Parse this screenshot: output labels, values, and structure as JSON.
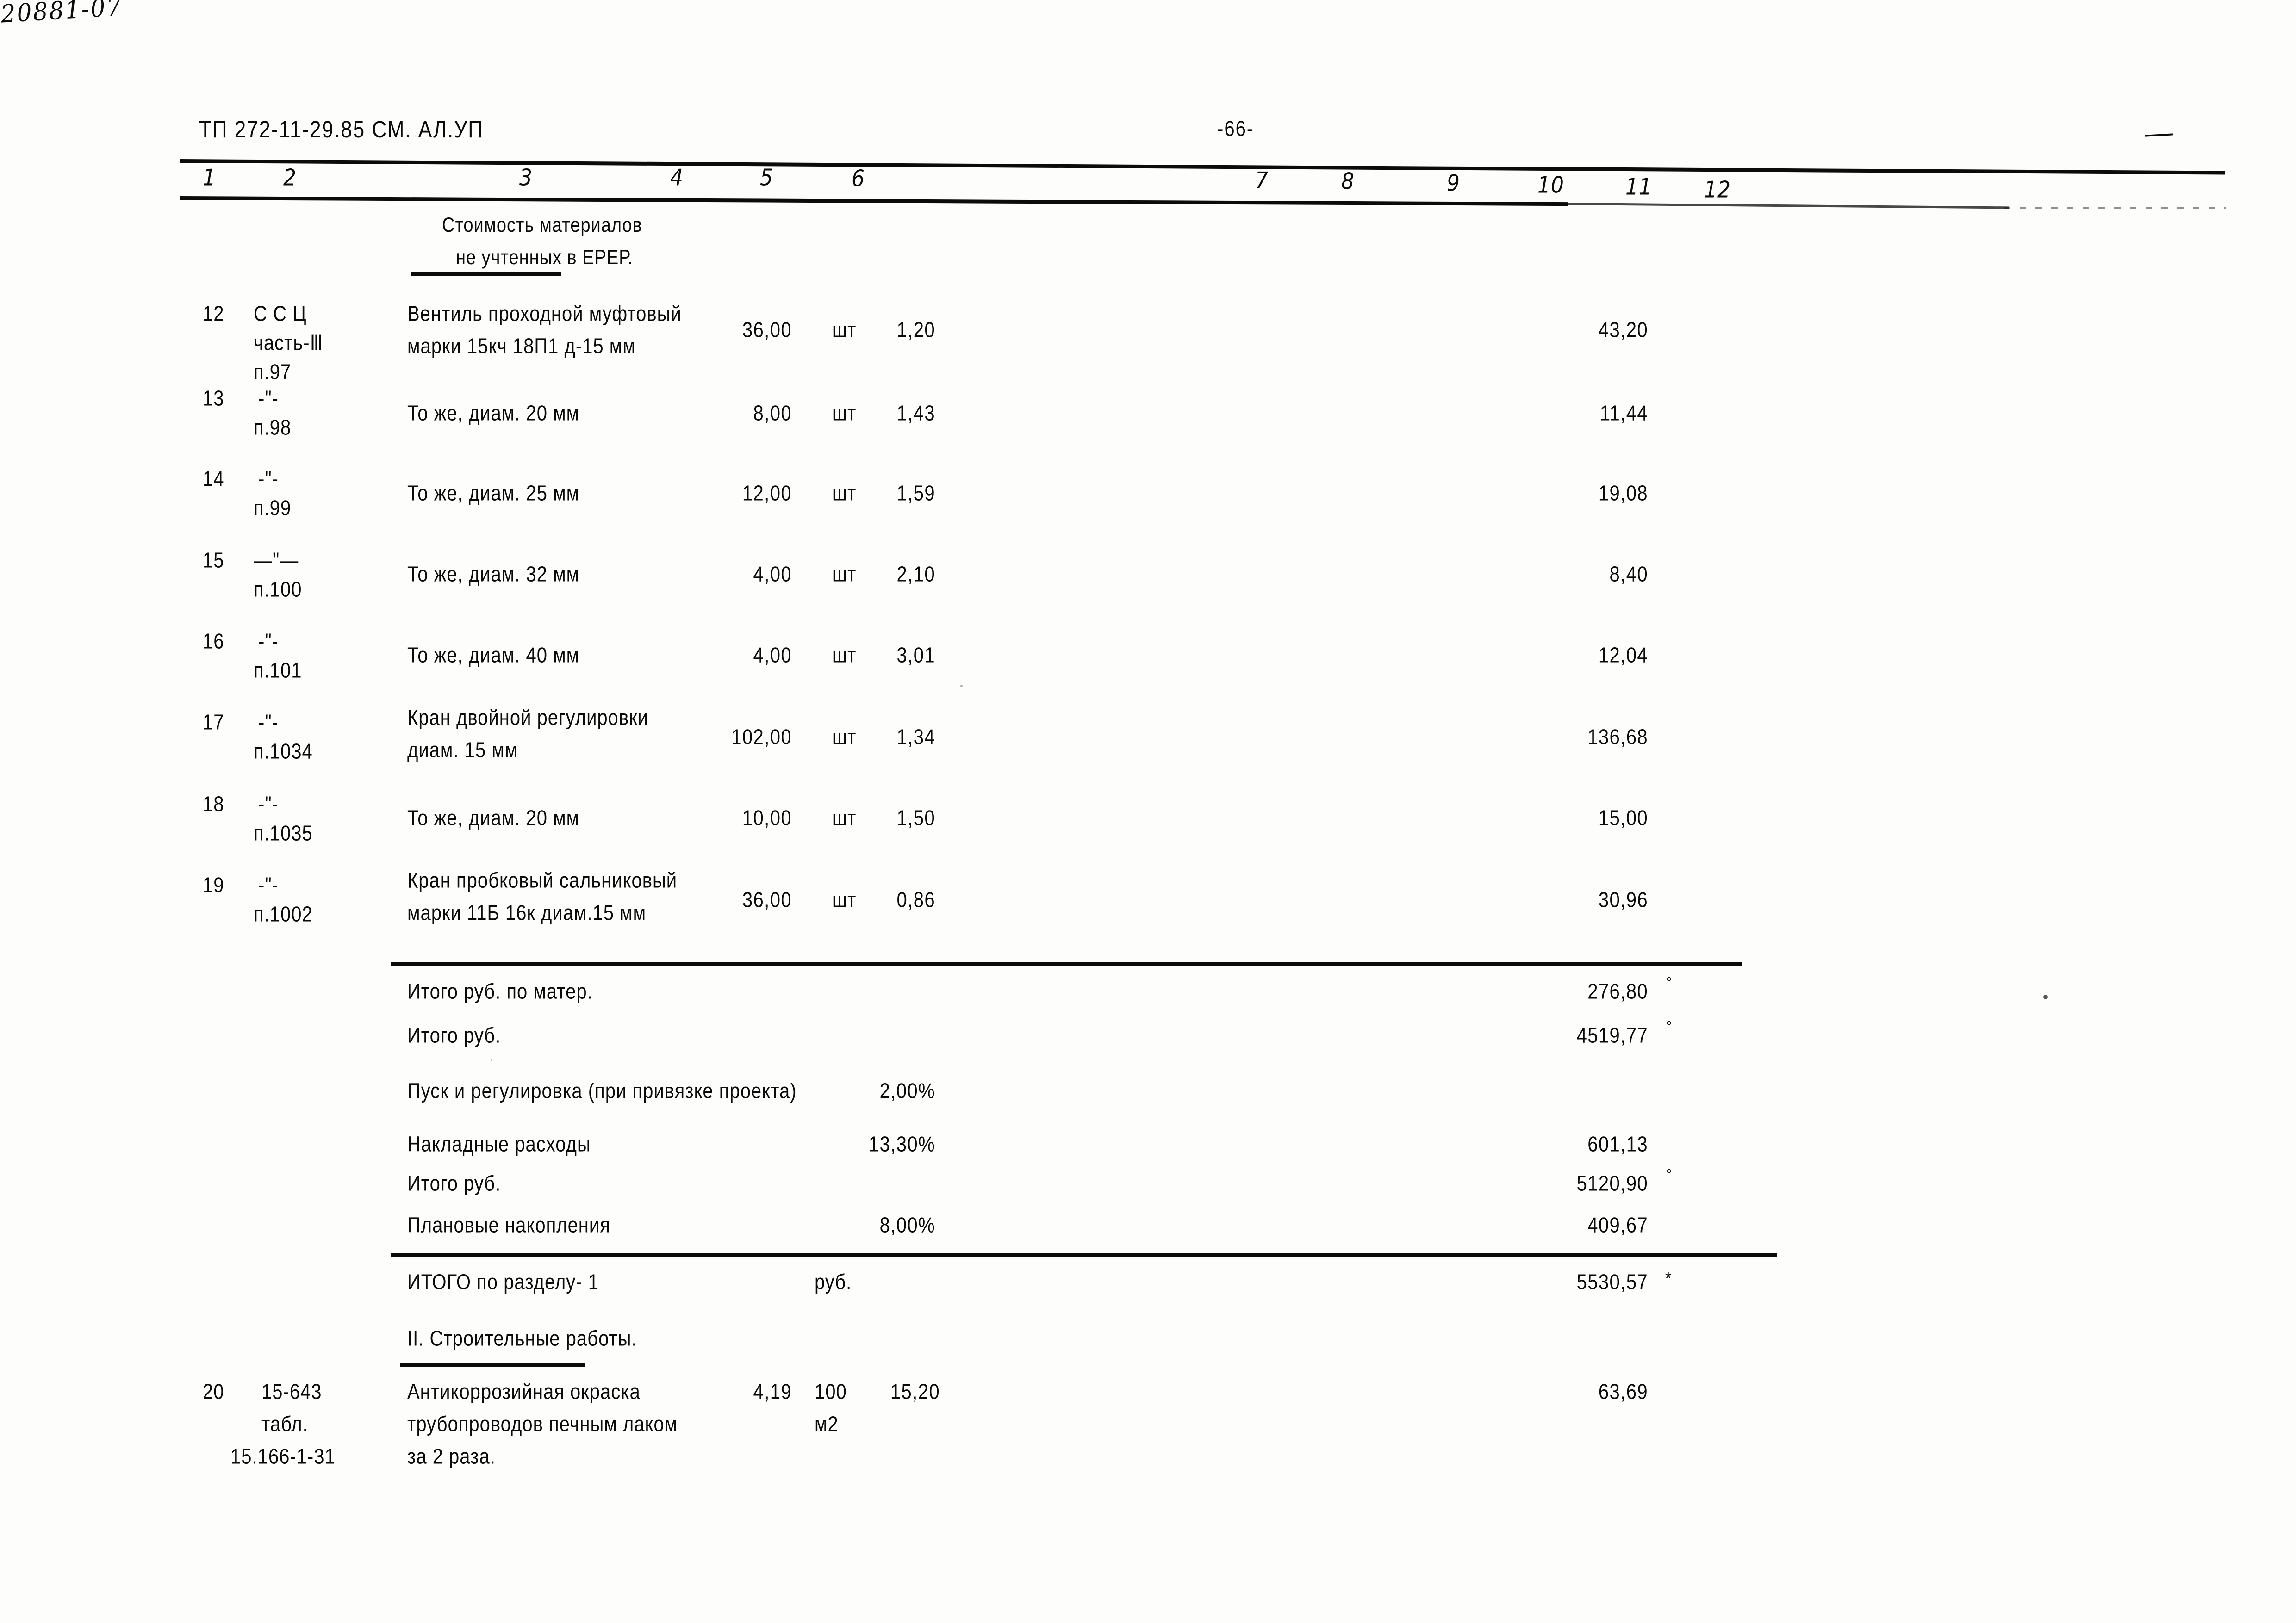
{
  "document": {
    "header_code": "ТП 272-11-29.85 СМ. АЛ.УП",
    "page_number": "-66-",
    "archive_stamp": "20881-07"
  },
  "table": {
    "column_numbers": [
      "1",
      "2",
      "3",
      "4",
      "5",
      "6",
      "7",
      "8",
      "9",
      "10",
      "11",
      "12"
    ],
    "section_caption": {
      "line1": "Стоимость материалов",
      "line2": "не учтенных в ЕРЕР."
    },
    "rows": [
      {
        "no": "12",
        "code_line1": "С С Ц",
        "code_line2": "часть-Ⅲ",
        "code_line3": "п.97",
        "name_line1": "Вентиль проходной муфтовый",
        "name_line2": "марки 15кч 18П1 д-15 мм",
        "unit": "шт",
        "qty": "36,00",
        "price": "1,20",
        "total": "43,20"
      },
      {
        "no": "13",
        "code_line1": "-\"-",
        "code_line2": "п.98",
        "code_line3": "",
        "name_line1": "То же, диам. 20 мм",
        "name_line2": "",
        "unit": "шт",
        "qty": "8,00",
        "price": "1,43",
        "total": "11,44"
      },
      {
        "no": "14",
        "code_line1": "-\"-",
        "code_line2": "п.99",
        "code_line3": "",
        "name_line1": "То же, диам. 25 мм",
        "name_line2": "",
        "unit": "шт",
        "qty": "12,00",
        "price": "1,59",
        "total": "19,08"
      },
      {
        "no": "15",
        "code_line1": "—\"—",
        "code_line2": "п.100",
        "code_line3": "",
        "name_line1": "То же, диам. 32 мм",
        "name_line2": "",
        "unit": "шт",
        "qty": "4,00",
        "price": "2,10",
        "total": "8,40"
      },
      {
        "no": "16",
        "code_line1": "-\"-",
        "code_line2": "п.101",
        "code_line3": "",
        "name_line1": "То же, диам. 40 мм",
        "name_line2": "",
        "unit": "шт",
        "qty": "4,00",
        "price": "3,01",
        "total": "12,04"
      },
      {
        "no": "17",
        "code_line1": "-\"-",
        "code_line2": "п.1034",
        "code_line3": "",
        "name_line1": "Кран двойной регулировки",
        "name_line2": "диам. 15 мм",
        "unit": "шт",
        "qty": "102,00",
        "price": "1,34",
        "total": "136,68"
      },
      {
        "no": "18",
        "code_line1": "-\"-",
        "code_line2": "п.1035",
        "code_line3": "",
        "name_line1": "То же, диам. 20 мм",
        "name_line2": "",
        "unit": "шт",
        "qty": "10,00",
        "price": "1,50",
        "total": "15,00"
      },
      {
        "no": "19",
        "code_line1": "-\"-",
        "code_line2": "п.1002",
        "code_line3": "",
        "name_line1": "Кран пробковый сальниковый",
        "name_line2": "марки 11Б 16к диам.15 мм",
        "unit": "шт",
        "qty": "36,00",
        "price": "0,86",
        "total": "30,96"
      }
    ],
    "summary": [
      {
        "label": "Итого руб. по матер.",
        "percent": "",
        "amount": "276,80",
        "mark": "°"
      },
      {
        "label": "Итого руб.",
        "percent": "",
        "amount": "4519,77",
        "mark": "°"
      },
      {
        "label": "Пуск и регулировка (при привязке проекта)",
        "percent": "2,00%",
        "amount": "",
        "mark": ""
      },
      {
        "label": "Накладные расходы",
        "percent": "13,30%",
        "amount": "601,13",
        "mark": ""
      },
      {
        "label": "Итого руб.",
        "percent": "",
        "amount": "5120,90",
        "mark": "°"
      },
      {
        "label": "Плановые накопления",
        "percent": "8,00%",
        "amount": "409,67",
        "mark": ""
      }
    ],
    "section_total": {
      "label": "ИТОГО по разделу- 1",
      "unit": "руб.",
      "amount": "5530,57",
      "mark": "*"
    },
    "next_section_title": "II. Строительные работы.",
    "last_row": {
      "no": "20",
      "code_line1": "15-643",
      "code_line2": "табл.",
      "code_line3": "15.166-1-31",
      "name_line1": "Антикоррозийная окраска",
      "name_line2": "трубопроводов печным лаком",
      "name_line3": "за 2 раза.",
      "unit_line1": "100",
      "unit_line2": "м2",
      "qty": "4,19",
      "price": "15,20",
      "total": "63,69"
    }
  }
}
